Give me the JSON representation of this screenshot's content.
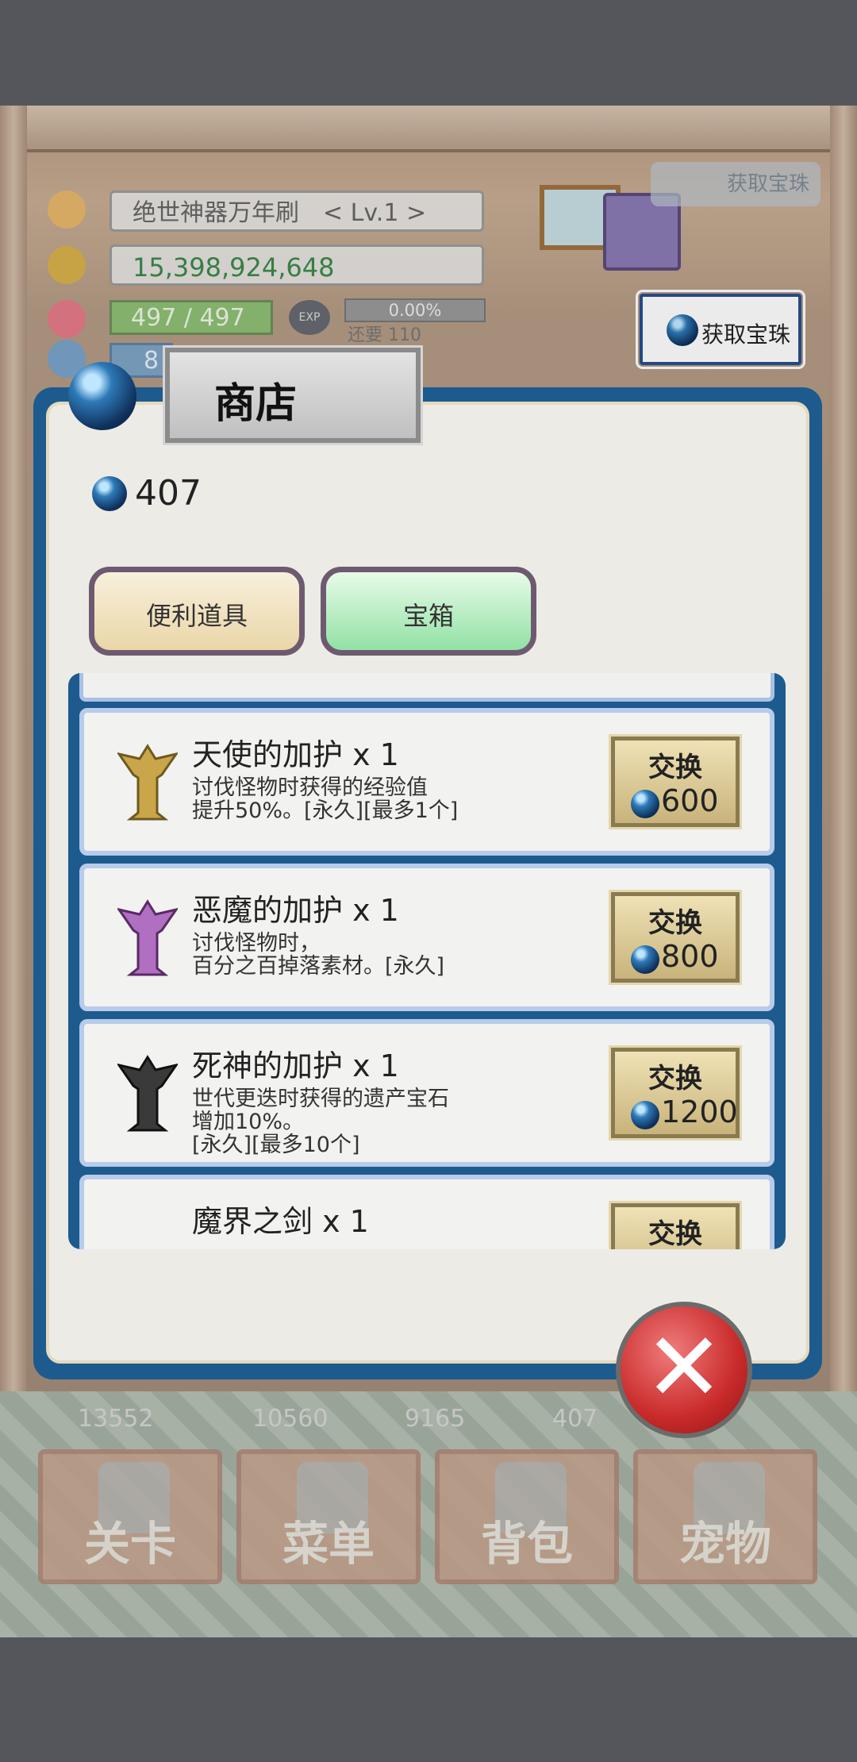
{
  "hud": {
    "player_name": "绝世神器万年刷　< Lv.1 >",
    "gold": "15,398,924,648",
    "hp": "497 / 497",
    "tp": "8",
    "exp_icon": "EXP",
    "exp_percent": "0.00%",
    "exp_remaining": "还要 110",
    "get_orb_button": "获取宝珠",
    "get_orb_icon_text": "获取宝珠"
  },
  "bottom": {
    "counts": [
      "13552",
      "10560",
      "9165",
      "407"
    ],
    "nav": [
      "关卡",
      "菜单",
      "背包",
      "宠物"
    ]
  },
  "shop": {
    "title": "商店",
    "balance": "407",
    "tabs": [
      "便利道具",
      "宝箱"
    ],
    "exchange_label": "交换",
    "items": [
      {
        "name": "天使的加护 x 1",
        "desc": "讨伐怪物时获得的经验值\n提升50%。[永久][最多1个]",
        "price": "600",
        "icon": "angel-statue-icon",
        "color": "#c9a64a"
      },
      {
        "name": "恶魔的加护 x 1",
        "desc": "讨伐怪物时，\n百分之百掉落素材。[永久]",
        "price": "800",
        "icon": "demon-statue-icon",
        "color": "#b06fc0"
      },
      {
        "name": "死神的加护 x 1",
        "desc": "世代更迭时获得的遗产宝石\n增加10%。\n[永久][最多10个]",
        "price": "1200",
        "icon": "reaper-statue-icon",
        "color": "#3a3a3a"
      },
      {
        "name": "魔界之剑 x 1",
        "desc": "",
        "price": "",
        "icon": "demon-sword-icon",
        "color": "#6a3a9a"
      }
    ]
  },
  "colors": {
    "frame_blue": "#1d5b8e",
    "tab_green": "#92e1a5",
    "close_red": "#c92a2a"
  }
}
